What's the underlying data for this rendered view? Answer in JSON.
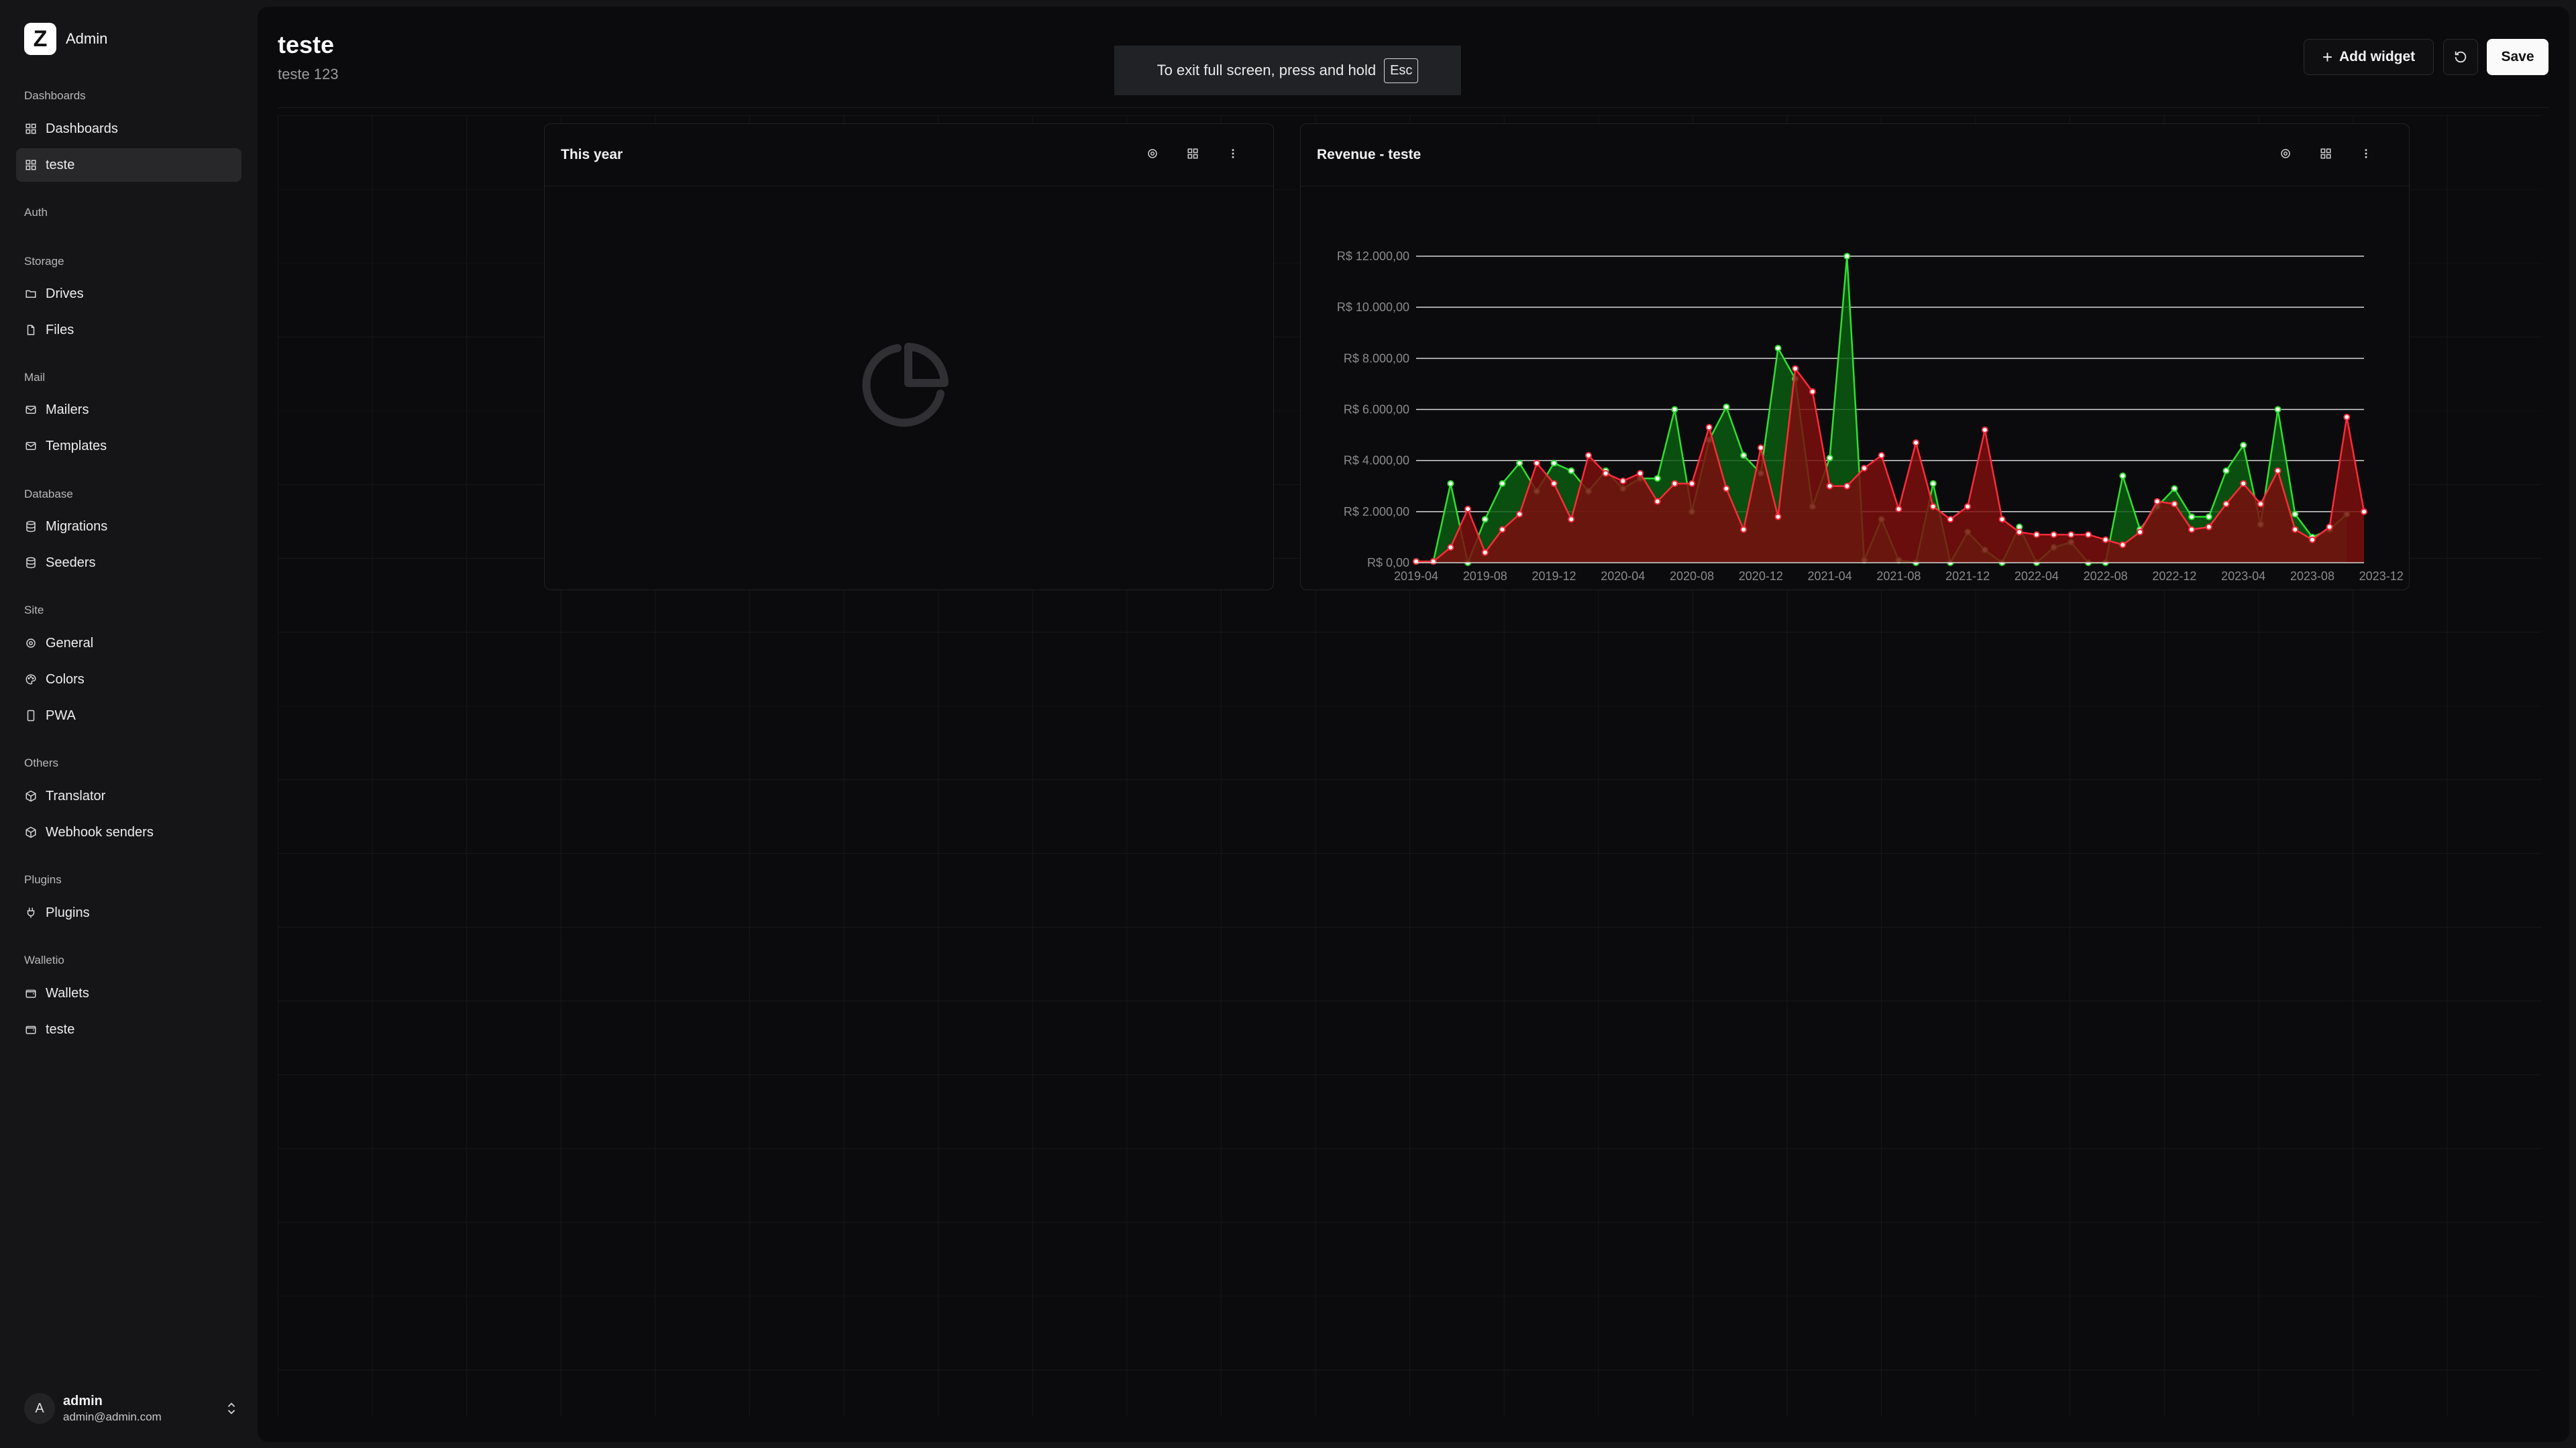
{
  "app": {
    "logo_letter": "Z",
    "name": "Admin"
  },
  "sidebar": {
    "groups": [
      {
        "label": "Dashboards",
        "items": [
          {
            "label": "Dashboards",
            "icon": "layout-grid-icon"
          },
          {
            "label": "teste",
            "icon": "layout-grid-icon",
            "active": true
          }
        ]
      },
      {
        "label": "Auth",
        "items": []
      },
      {
        "label": "Storage",
        "items": [
          {
            "label": "Drives",
            "icon": "folder-icon"
          },
          {
            "label": "Files",
            "icon": "file-icon"
          }
        ]
      },
      {
        "label": "Mail",
        "items": [
          {
            "label": "Mailers",
            "icon": "mail-icon"
          },
          {
            "label": "Templates",
            "icon": "mail-icon"
          }
        ]
      },
      {
        "label": "Database",
        "items": [
          {
            "label": "Migrations",
            "icon": "database-icon"
          },
          {
            "label": "Seeders",
            "icon": "database-icon"
          }
        ]
      },
      {
        "label": "Site",
        "items": [
          {
            "label": "General",
            "icon": "gear-icon"
          },
          {
            "label": "Colors",
            "icon": "palette-icon"
          },
          {
            "label": "PWA",
            "icon": "smartphone-icon"
          }
        ]
      },
      {
        "label": "Others",
        "items": [
          {
            "label": "Translator",
            "icon": "box-icon"
          },
          {
            "label": "Webhook senders",
            "icon": "box-icon"
          }
        ]
      },
      {
        "label": "Plugins",
        "items": [
          {
            "label": "Plugins",
            "icon": "plug-icon"
          }
        ]
      },
      {
        "label": "Walletio",
        "items": [
          {
            "label": "Wallets",
            "icon": "wallet-icon"
          },
          {
            "label": "teste",
            "icon": "wallet-icon"
          }
        ]
      }
    ]
  },
  "user": {
    "avatar_letter": "A",
    "name": "admin",
    "email": "admin@admin.com"
  },
  "header": {
    "title": "teste",
    "subtitle": "teste 123",
    "add_widget_label": "Add widget",
    "save_label": "Save"
  },
  "toast": {
    "text": "To exit full screen, press and hold",
    "key": "Esc"
  },
  "widgets": [
    {
      "title": "This year"
    },
    {
      "title": "Revenue - teste"
    }
  ],
  "colors": {
    "green_series": "#2fe02f",
    "red_series": "#ff2a3a",
    "green_fill": "#0b5a12",
    "red_fill": "#7a0e0e"
  },
  "chart_data": {
    "type": "area",
    "title": "Revenue - teste",
    "ylim": [
      0,
      12000
    ],
    "y_ticks": [
      "R$ 0,00",
      "R$ 2.000,00",
      "R$ 4.000,00",
      "R$ 6.000,00",
      "R$ 8.000,00",
      "R$ 10.000,00",
      "R$ 12.000,00"
    ],
    "x_ticks": [
      "2019-04",
      "2019-08",
      "2019-12",
      "2020-04",
      "2020-08",
      "2020-12",
      "2021-04",
      "2021-08",
      "2021-12",
      "2022-04",
      "2022-08",
      "2022-12",
      "2023-04",
      "2023-08",
      "2023-12"
    ],
    "x_start": "2019-04",
    "series": [
      {
        "color": "green",
        "values": [
          50,
          50,
          3100,
          0,
          1700,
          3100,
          3900,
          2800,
          3900,
          3600,
          2800,
          3600,
          2900,
          3300,
          3300,
          6000,
          2000,
          4800,
          6100,
          4200,
          3500,
          8400,
          7200,
          2200,
          4100,
          12000,
          100,
          1700,
          100,
          0,
          3100,
          0,
          1200,
          500,
          0,
          1400,
          0,
          600,
          800,
          0,
          0,
          3400,
          1300,
          2200,
          2900,
          1800,
          1800,
          3600,
          4600,
          1500,
          6000,
          1900,
          1000,
          1300,
          1900
        ]
      },
      {
        "color": "red",
        "values": [
          50,
          50,
          600,
          2100,
          400,
          1300,
          1900,
          3900,
          3100,
          1700,
          4200,
          3500,
          3200,
          3500,
          2400,
          3100,
          3100,
          5300,
          2900,
          1300,
          4500,
          1800,
          7600,
          6700,
          3000,
          3000,
          3700,
          4200,
          2100,
          4700,
          2200,
          1700,
          2200,
          5200,
          1700,
          1200,
          1100,
          1100,
          1100,
          1100,
          900,
          700,
          1200,
          2400,
          2300,
          1300,
          1400,
          2300,
          3100,
          2300,
          3600,
          1300,
          900,
          1400,
          5700,
          2000
        ]
      }
    ]
  }
}
